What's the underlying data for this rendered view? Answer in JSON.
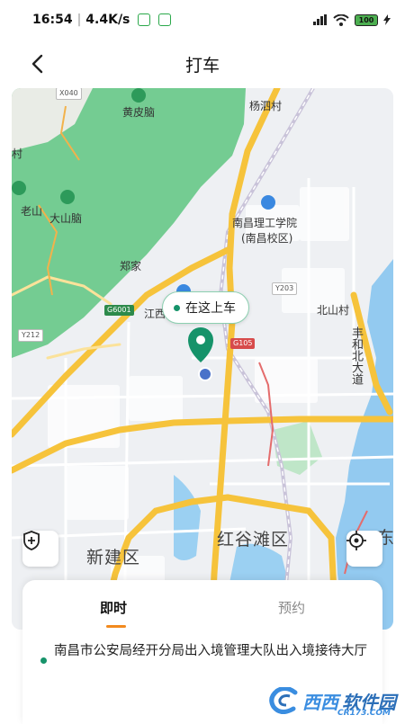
{
  "status_bar": {
    "time": "16:54",
    "speed": "4.4K/s",
    "battery": "100"
  },
  "header": {
    "title": "打车"
  },
  "map": {
    "labels": {
      "huangpinao": "黄皮脑",
      "yangsicun": "杨泗村",
      "laoshan": "老山",
      "dashannao": "大山脑",
      "nanchang_institute": "南昌理工学院",
      "nanchang_campus": "(南昌校区)",
      "zhengjia": "郑家",
      "jiang": "江西",
      "beishancun": "北山村",
      "fenghe_road": "丰和北大道",
      "xinjian": "新建区",
      "honggutan": "红谷滩区",
      "dong": "东",
      "cun": "村"
    },
    "road_tags": {
      "x040": "X040",
      "g6001": "G6001",
      "y212": "Y212",
      "y203": "Y203",
      "g105": "G105"
    },
    "pickup_tip": "在这上车",
    "colors": {
      "green_area": "#6fc98e",
      "water": "#8fc9f0",
      "highway": "#f6c33b",
      "pin": "#16936a",
      "location_dot": "#4a72c9"
    }
  },
  "panel": {
    "tab_now": "即时",
    "tab_book": "预约",
    "origin": "南昌市公安局经开分局出入境管理大队出入境接待大厅",
    "accent": "#f28a1e"
  },
  "watermark": {
    "text1": "西西",
    "text2": "软件园",
    "sub": "CR173.COM"
  }
}
